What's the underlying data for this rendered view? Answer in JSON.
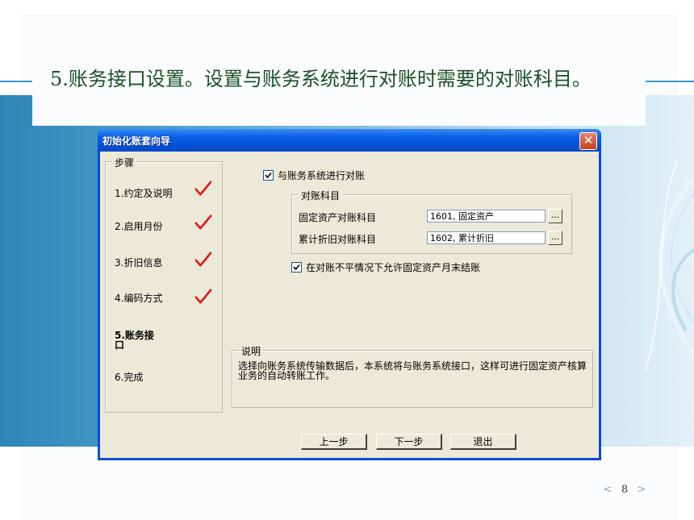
{
  "slide": {
    "title": "5.账务接口设置。设置与账务系统进行对账时需要的对账科目。",
    "page_number": "8",
    "prev_arrow": "<",
    "next_arrow": ">"
  },
  "dialog": {
    "title": "初始化账套向导",
    "close_glyph": "✕",
    "steps_legend": "步骤",
    "steps": [
      {
        "label": "1.约定及说明",
        "done": true
      },
      {
        "label": "2.启用月份",
        "done": true
      },
      {
        "label": "3.折旧信息",
        "done": true
      },
      {
        "label": "4.编码方式",
        "done": true
      },
      {
        "label": "5.账务接口",
        "done": false,
        "current": true
      },
      {
        "label": "6.完成",
        "done": false
      }
    ],
    "reconcile_checkbox": {
      "label": "与账务系统进行对账",
      "checked": true
    },
    "subjects_legend": "对账科目",
    "fixed_asset_label": "固定资产对账科目",
    "fixed_asset_value": "1601, 固定资产",
    "depreciation_label": "累计折旧对账科目",
    "depreciation_value": "1602, 累计折旧",
    "browse_glyph": "...",
    "allow_checkbox": {
      "label": "在对账不平情况下允许固定资产月末结账",
      "checked": true
    },
    "desc_legend": "说明",
    "desc_text": "选择向账务系统传输数据后，本系统将与账务系统接口，这样可进行固定资产核算业务的自动转账工作。",
    "buttons": {
      "prev": "上一步",
      "next": "下一步",
      "exit": "退出"
    }
  },
  "colors": {
    "check_mark": "#e0201a",
    "title_text": "#1b4f2a",
    "titlebar": "#0a5fe6",
    "band": "#4da0cc"
  }
}
